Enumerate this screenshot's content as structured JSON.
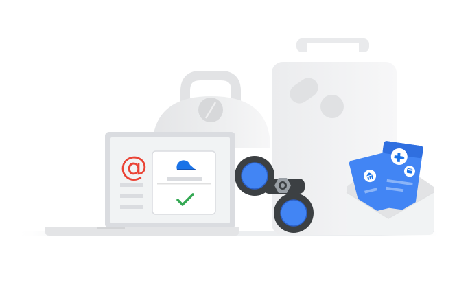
{
  "illustration": {
    "laptop": {
      "email_symbol": "@",
      "has_cloud_icon": true,
      "has_check_icon": true
    },
    "colors": {
      "accent_blue": "#4285f4",
      "dark_blue": "#1a73e8",
      "at_red": "#ea4335",
      "check_green": "#34a853",
      "dark_lens": "#3c4043",
      "light_gray": "#e8eaed",
      "mid_gray": "#dadce0",
      "screen_gray": "#f1f3f4"
    },
    "icons": [
      "cloud-icon",
      "check-icon",
      "airplane-icon",
      "bus-icon",
      "bank-icon",
      "gear-icon",
      "binoculars-icon",
      "suitcase-icon",
      "helmet-icon",
      "envelope-icon"
    ]
  }
}
